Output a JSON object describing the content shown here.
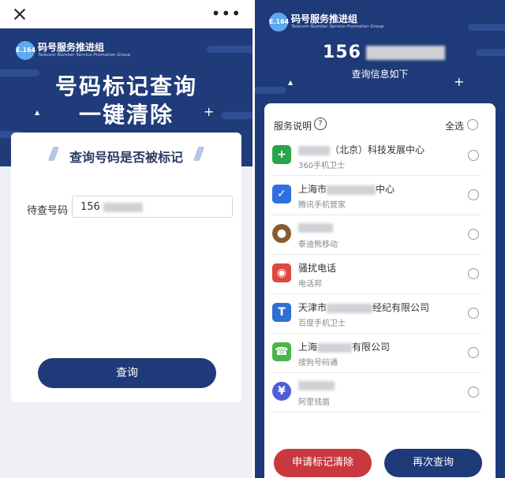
{
  "left": {
    "logo": {
      "badge": "E.164",
      "title": "码号服务推进组",
      "subtitle": "Telecom Number Service Promotion Group"
    },
    "hero_line1": "号码标记查询",
    "hero_line2": "一键清除",
    "form_title": "查询号码是否被标记",
    "field_label": "待查号码",
    "field_value": "156",
    "query_button": "查询"
  },
  "right": {
    "logo": {
      "badge": "E.164",
      "title": "码号服务推进组",
      "subtitle": "Telecom Number Service Promotion Group"
    },
    "phone_prefix": "156",
    "info_text": "查询信息如下",
    "service_label": "服务说明",
    "help_glyph": "?",
    "select_all": "全选",
    "items": [
      {
        "name_after": "（北京）科技发展中心",
        "app": "360手机卫士",
        "color": "#2aa54a",
        "glyph": "+"
      },
      {
        "name_before": "上海市",
        "name_after": "中心",
        "app": "腾讯手机管家",
        "color": "#2f6fe0",
        "glyph": "✓"
      },
      {
        "app": "泰迪熊移动",
        "color": "#8a5a2e",
        "glyph": "●"
      },
      {
        "name_before": "骚扰电话",
        "app": "电话邦",
        "color": "#e0473f",
        "glyph": "◉"
      },
      {
        "name_before": "天津市",
        "name_after": "经纪有限公司",
        "app": "百度手机卫士",
        "color": "#2e6fd1",
        "glyph": "T"
      },
      {
        "name_before": "上海",
        "name_after": "有限公司",
        "app": "搜狗号码通",
        "color": "#4db34b",
        "glyph": "☎"
      },
      {
        "app": "阿里钱盾",
        "color": "#4c5fd6",
        "glyph": "¥"
      }
    ],
    "apply_button": "申请标记清除",
    "again_button": "再次查询"
  }
}
